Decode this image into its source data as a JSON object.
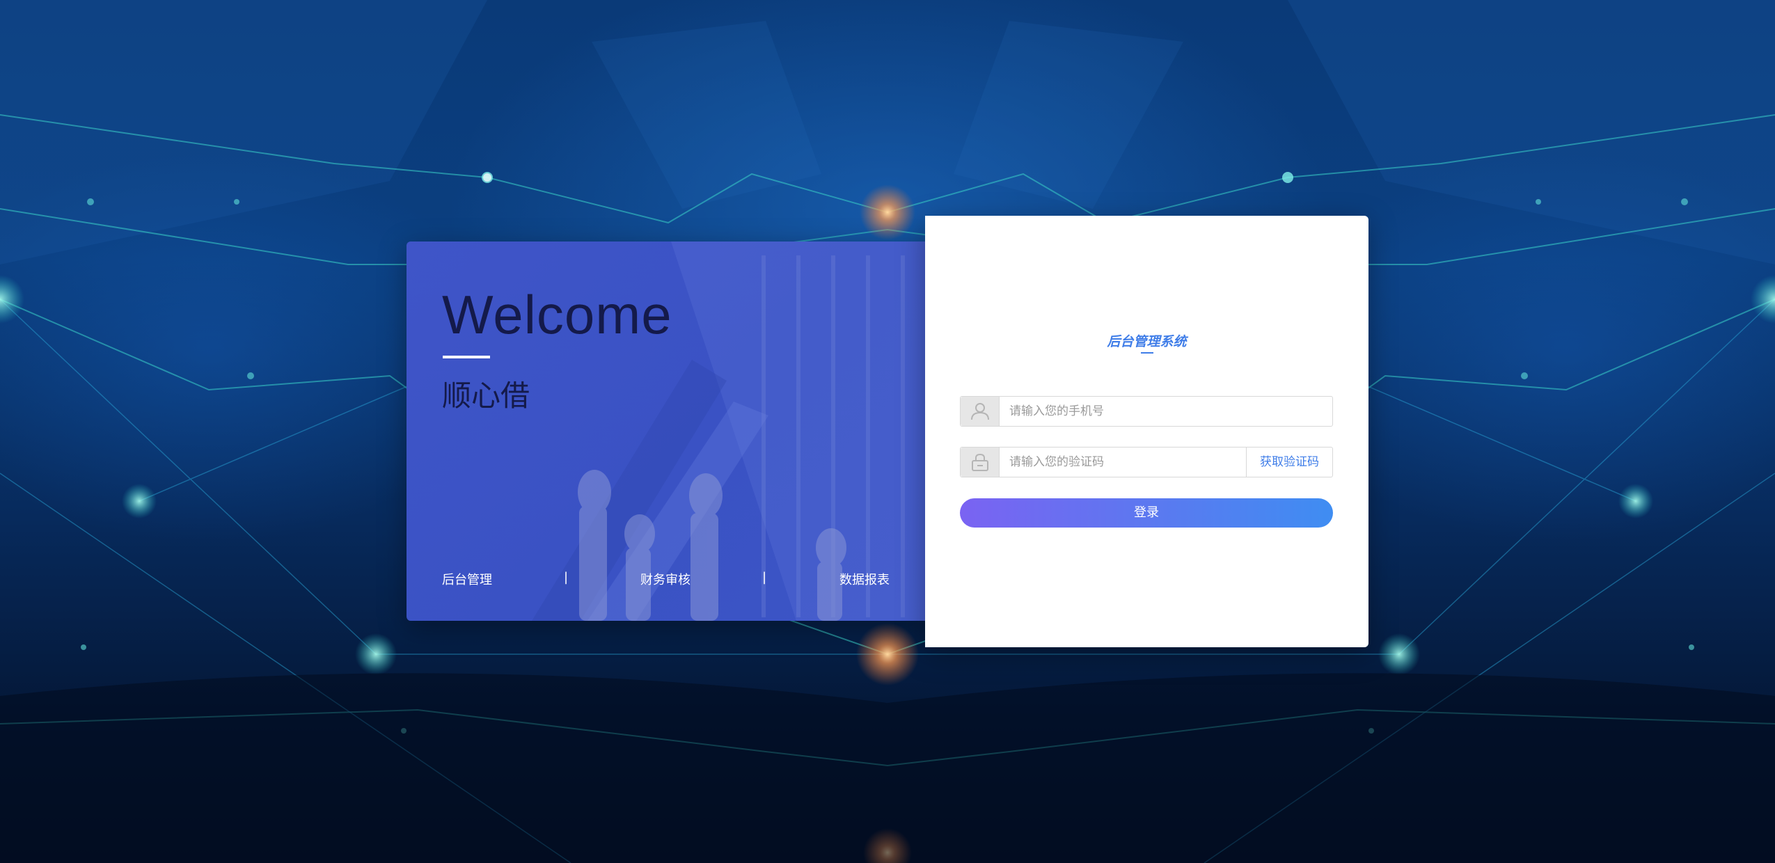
{
  "welcome": {
    "title": "Welcome",
    "subtitle": "顺心借"
  },
  "panel_nav": {
    "items": [
      "后台管理",
      "财务审核",
      "数据报表"
    ],
    "separator": "|"
  },
  "login": {
    "system_title": "后台管理系统",
    "phone_placeholder": "请输入您的手机号",
    "code_placeholder": "请输入您的验证码",
    "get_code_label": "获取验证码",
    "submit_label": "登录"
  },
  "icons": {
    "phone_field": "user-icon",
    "code_field": "lock-icon"
  },
  "colors": {
    "accent": "#3f7de8",
    "button_start": "#7a63f2",
    "button_end": "#3f8df2",
    "panel": "#3f55c8"
  }
}
